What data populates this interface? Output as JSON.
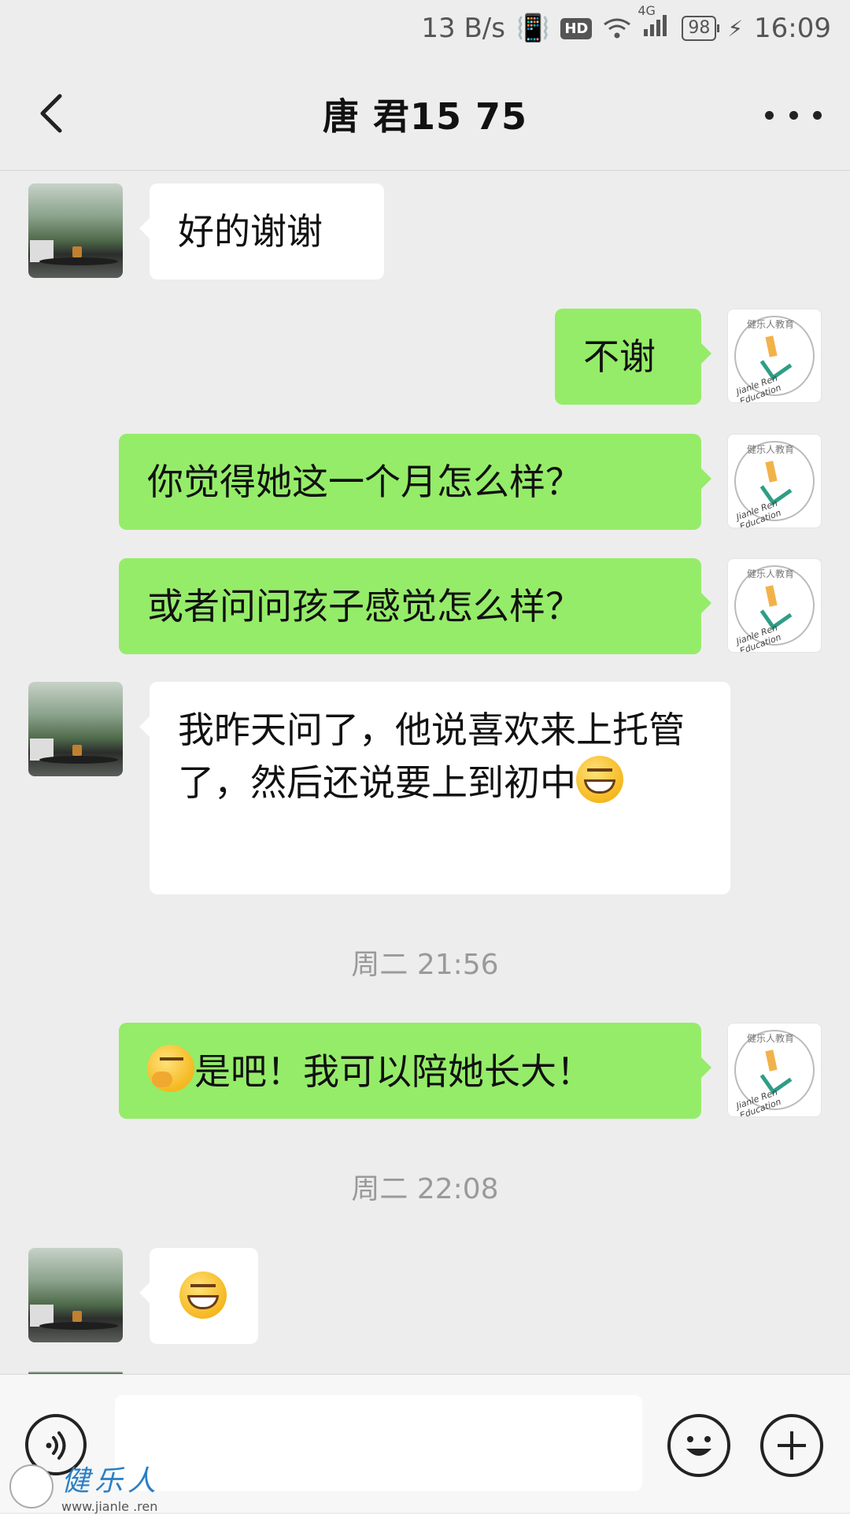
{
  "status_bar": {
    "speed": "13 B/s",
    "hd": "HD",
    "net": "4G",
    "battery": "98",
    "time": "16:09"
  },
  "header": {
    "title": "唐  君15        75",
    "back_icon": "chevron-left-icon",
    "more_icon": "more-dots-icon"
  },
  "messages": [
    {
      "from": "contact",
      "text": "好的谢谢"
    },
    {
      "from": "me",
      "text": "不谢"
    },
    {
      "from": "me",
      "text": "你觉得她这一个月怎么样？"
    },
    {
      "from": "me",
      "text": "或者问问孩子感觉怎么样？"
    },
    {
      "from": "contact",
      "text": "我昨天问了，他说喜欢来上托管了，然后还说要上到初中",
      "emoji": "grin-emoji"
    },
    {
      "from": "me",
      "text": "是吧！我可以陪她长大！",
      "emoji_prefix": "thinking-emoji"
    },
    {
      "from": "contact",
      "emoji": "grin-emoji"
    }
  ],
  "timestamps": [
    "周二 21:56",
    "周二 22:08"
  ],
  "input_bar": {
    "placeholder": "",
    "voice_icon": "voice-icon",
    "emoji_icon": "smiley-icon",
    "plus_icon": "plus-icon"
  },
  "watermark": {
    "name": "健乐人",
    "url": "www.jianle .ren"
  },
  "colors": {
    "background": "#ededed",
    "outgoing_bubble": "#95ec69",
    "incoming_bubble": "#ffffff"
  }
}
